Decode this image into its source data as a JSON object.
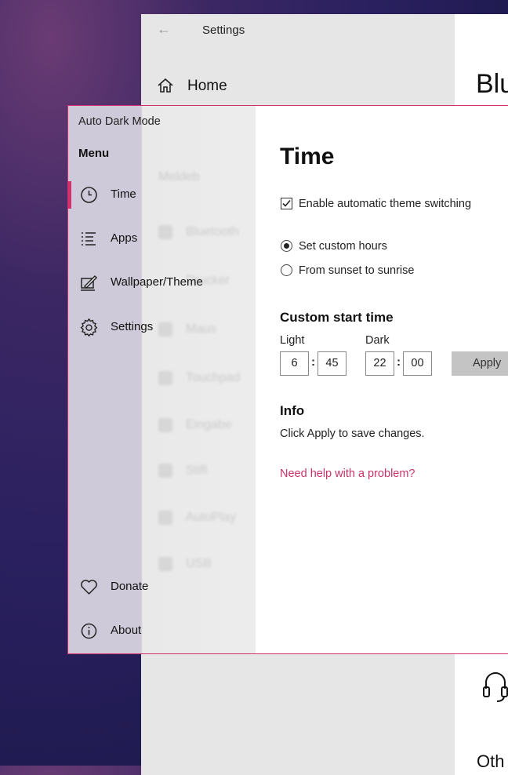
{
  "background_window": {
    "title": "Settings",
    "home_label": "Home",
    "page_heading_partial": "Blu",
    "section_partial": "Oth"
  },
  "app": {
    "title": "Auto Dark Mode",
    "accent_color": "#d0306c"
  },
  "sidebar": {
    "heading": "Menu",
    "items": [
      {
        "label": "Time",
        "icon": "clock-icon",
        "active": true
      },
      {
        "label": "Apps",
        "icon": "list-icon",
        "active": false
      },
      {
        "label": "Wallpaper/Theme",
        "icon": "paint-icon",
        "active": false
      },
      {
        "label": "Settings",
        "icon": "gear-icon",
        "active": false
      }
    ],
    "bottom_items": [
      {
        "label": "Donate",
        "icon": "heart-icon"
      },
      {
        "label": "About",
        "icon": "info-icon"
      }
    ]
  },
  "main": {
    "title": "Time",
    "auto_switch": {
      "label": "Enable automatic theme switching",
      "checked": true
    },
    "mode_options": [
      {
        "label": "Set custom hours",
        "selected": true
      },
      {
        "label": "From sunset to sunrise",
        "selected": false
      }
    ],
    "custom_start": {
      "heading": "Custom start time",
      "light_label": "Light",
      "dark_label": "Dark",
      "light_hour": "6",
      "light_minute": "45",
      "dark_hour": "22",
      "dark_minute": "00",
      "separator": ":",
      "apply_label": "Apply"
    },
    "info": {
      "heading": "Info",
      "text": "Click Apply to save changes."
    },
    "help_link": "Need help with a problem?"
  }
}
